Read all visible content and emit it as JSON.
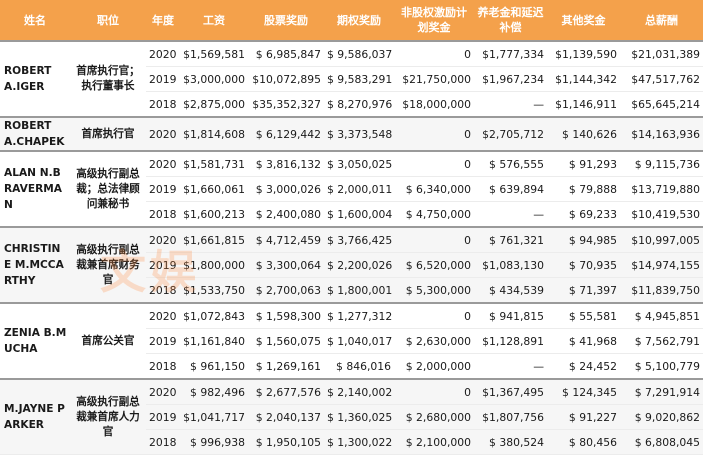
{
  "headers": [
    "姓名",
    "职位",
    "年度",
    "工资",
    "股票奖励",
    "期权奖励",
    "非股权激励计划奖金",
    "养老金和延迟补偿",
    "其他奖金",
    "总薪酬"
  ],
  "groups": [
    {
      "name": "ROBERT A.IGER",
      "position": "首席执行官；执行董事长",
      "rows": [
        {
          "year": "2020",
          "salary": "$1,569,581",
          "stock": "$ 6,985,847",
          "option": "$ 9,586,037",
          "nonequity": "0",
          "pension": "$1,777,334",
          "other": "$1,139,590",
          "total": "$21,031,389"
        },
        {
          "year": "2019",
          "salary": "$3,000,000",
          "stock": "$10,072,895",
          "option": "$ 9,583,291",
          "nonequity": "$21,750,000",
          "pension": "$1,967,234",
          "other": "$1,144,342",
          "total": "$47,517,762"
        },
        {
          "year": "2018",
          "salary": "$2,875,000",
          "stock": "$35,352,327",
          "option": "$ 8,270,976",
          "nonequity": "$18,000,000",
          "pension": "—",
          "other": "$1,146,911",
          "total": "$65,645,214"
        }
      ]
    },
    {
      "name": "ROBERT A.CHAPEK",
      "position": "首席执行官",
      "rows": [
        {
          "year": "2020",
          "salary": "$1,814,608",
          "stock": "$ 6,129,442",
          "option": "$ 3,373,548",
          "nonequity": "0",
          "pension": "$2,705,712",
          "other": "$ 140,626",
          "total": "$14,163,936"
        }
      ]
    },
    {
      "name": "ALAN N.BRAVERMAN",
      "position": "高级执行副总裁；总法律顾问兼秘书",
      "rows": [
        {
          "year": "2020",
          "salary": "$1,581,731",
          "stock": "$ 3,816,132",
          "option": "$ 3,050,025",
          "nonequity": "0",
          "pension": "$ 576,555",
          "other": "$ 91,293",
          "total": "$ 9,115,736"
        },
        {
          "year": "2019",
          "salary": "$1,660,061",
          "stock": "$ 3,000,026",
          "option": "$ 2,000,011",
          "nonequity": "$ 6,340,000",
          "pension": "$ 639,894",
          "other": "$ 79,888",
          "total": "$13,719,880"
        },
        {
          "year": "2018",
          "salary": "$1,600,213",
          "stock": "$ 2,400,080",
          "option": "$ 1,600,004",
          "nonequity": "$ 4,750,000",
          "pension": "—",
          "other": "$ 69,233",
          "total": "$10,419,530"
        }
      ]
    },
    {
      "name": "CHRISTINE M.MCCARTHY",
      "position": "高级执行副总裁兼首席财务官",
      "rows": [
        {
          "year": "2020",
          "salary": "$1,661,815",
          "stock": "$ 4,712,459",
          "option": "$ 3,766,425",
          "nonequity": "0",
          "pension": "$ 761,321",
          "other": "$ 94,985",
          "total": "$10,997,005"
        },
        {
          "year": "2019",
          "salary": "$1,800,000",
          "stock": "$ 3,300,064",
          "option": "$ 2,200,026",
          "nonequity": "$ 6,520,000",
          "pension": "$1,083,130",
          "other": "$ 70,935",
          "total": "$14,974,155"
        },
        {
          "year": "2018",
          "salary": "$1,533,750",
          "stock": "$ 2,700,063",
          "option": "$ 1,800,001",
          "nonequity": "$ 5,300,000",
          "pension": "$ 434,539",
          "other": "$ 71,397",
          "total": "$11,839,750"
        }
      ]
    },
    {
      "name": "ZENIA B.MUCHA",
      "position": "首席公关官",
      "rows": [
        {
          "year": "2020",
          "salary": "$1,072,843",
          "stock": "$ 1,598,300",
          "option": "$ 1,277,312",
          "nonequity": "0",
          "pension": "$ 941,815",
          "other": "$ 55,581",
          "total": "$ 4,945,851"
        },
        {
          "year": "2019",
          "salary": "$1,161,840",
          "stock": "$ 1,560,075",
          "option": "$ 1,040,017",
          "nonequity": "$ 2,630,000",
          "pension": "$1,128,891",
          "other": "$ 41,968",
          "total": "$ 7,562,791"
        },
        {
          "year": "2018",
          "salary": "$ 961,150",
          "stock": "$ 1,269,161",
          "option": "$ 846,016",
          "nonequity": "$ 2,000,000",
          "pension": "—",
          "other": "$ 24,452",
          "total": "$ 5,100,779"
        }
      ]
    },
    {
      "name": "M.JAYNE PARKER",
      "position": "高级执行副总裁兼首席人力官",
      "rows": [
        {
          "year": "2020",
          "salary": "$ 982,496",
          "stock": "$ 2,677,576",
          "option": "$ 2,140,002",
          "nonequity": "0",
          "pension": "$1,367,495",
          "other": "$ 124,345",
          "total": "$ 7,291,914"
        },
        {
          "year": "2019",
          "salary": "$1,041,717",
          "stock": "$ 2,040,137",
          "option": "$ 1,360,025",
          "nonequity": "$ 2,680,000",
          "pension": "$1,807,756",
          "other": "$ 91,227",
          "total": "$ 9,020,862"
        },
        {
          "year": "2018",
          "salary": "$ 996,938",
          "stock": "$ 1,950,105",
          "option": "$ 1,300,022",
          "nonequity": "$ 2,100,000",
          "pension": "$ 380,524",
          "other": "$ 80,456",
          "total": "$ 6,808,045"
        }
      ]
    }
  ],
  "watermark": {
    "text": "文娱",
    "color": "#ff8a3d"
  },
  "colors": {
    "header_bg": "#f4a14b",
    "header_text": "#ffffff",
    "shade": "#f6f6f6",
    "group_border": "#9a9a9a"
  }
}
